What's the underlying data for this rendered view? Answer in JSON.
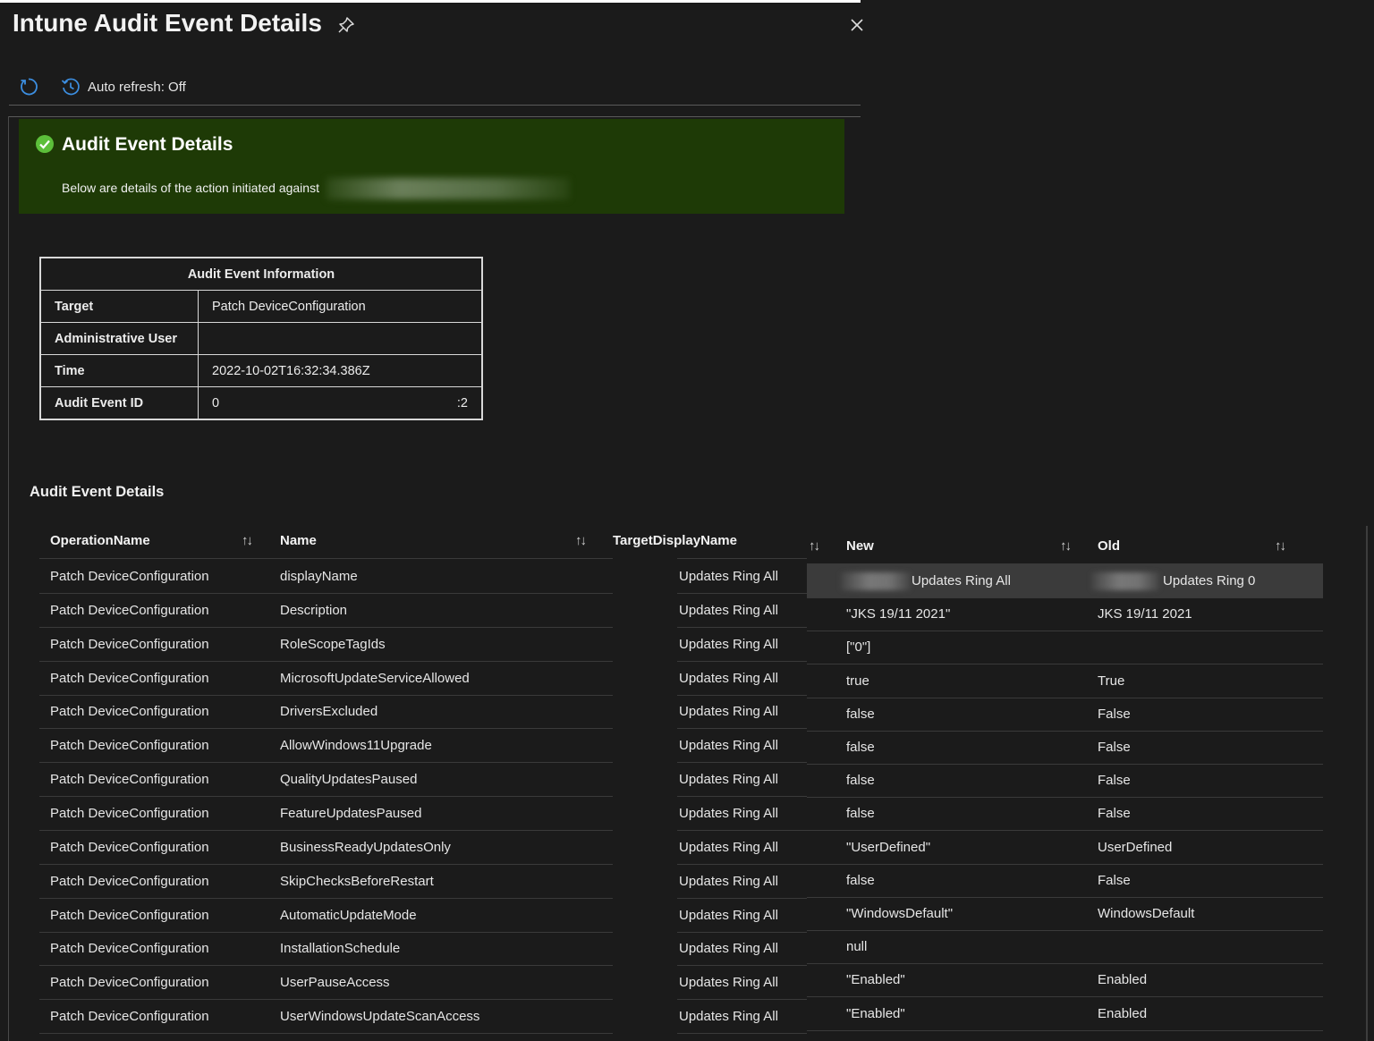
{
  "header": {
    "title": "Intune Audit Event Details",
    "pin_icon": "pin-icon",
    "close_icon": "close-icon"
  },
  "toolbar": {
    "refresh_icon": "refresh-icon",
    "history_icon": "history-icon",
    "auto_refresh_label": "Auto refresh: Off"
  },
  "banner": {
    "icon": "check-circle-icon",
    "title": "Audit Event Details",
    "text": "Below are details of the action initiated against",
    "color": "#1e3a06"
  },
  "info_table": {
    "heading": "Audit Event Information",
    "rows": [
      {
        "label": "Target",
        "value": "Patch DeviceConfiguration"
      },
      {
        "label": "Administrative User",
        "value": ""
      },
      {
        "label": "Time",
        "value": "2022-10-02T16:32:34.386Z"
      },
      {
        "label": "Audit Event ID",
        "value": "0",
        "value_end": ":2"
      }
    ]
  },
  "details": {
    "title": "Audit Event Details",
    "columns": {
      "operation": "OperationName",
      "name": "Name",
      "target": "TargetDisplayName",
      "new": "New",
      "old": "Old"
    },
    "sort_icon": "↑↓",
    "rows": [
      {
        "op": "Patch DeviceConfiguration",
        "name": "displayName",
        "target": "Updates Ring All",
        "new": "Updates Ring All",
        "old": "Updates Ring 0"
      },
      {
        "op": "Patch DeviceConfiguration",
        "name": "Description",
        "target": "Updates Ring All",
        "new": "\"JKS 19/11 2021\"",
        "old": "JKS 19/11 2021"
      },
      {
        "op": "Patch DeviceConfiguration",
        "name": "RoleScopeTagIds",
        "target": "Updates Ring All",
        "new": "[\"0\"]",
        "old": ""
      },
      {
        "op": "Patch DeviceConfiguration",
        "name": "MicrosoftUpdateServiceAllowed",
        "target": "Updates Ring All",
        "new": "true",
        "old": "True"
      },
      {
        "op": "Patch DeviceConfiguration",
        "name": "DriversExcluded",
        "target": "Updates Ring All",
        "new": "false",
        "old": "False"
      },
      {
        "op": "Patch DeviceConfiguration",
        "name": "AllowWindows11Upgrade",
        "target": "Updates Ring All",
        "new": "false",
        "old": "False"
      },
      {
        "op": "Patch DeviceConfiguration",
        "name": "QualityUpdatesPaused",
        "target": "Updates Ring All",
        "new": "false",
        "old": "False"
      },
      {
        "op": "Patch DeviceConfiguration",
        "name": "FeatureUpdatesPaused",
        "target": "Updates Ring All",
        "new": "false",
        "old": "False"
      },
      {
        "op": "Patch DeviceConfiguration",
        "name": "BusinessReadyUpdatesOnly",
        "target": "Updates Ring All",
        "new": "\"UserDefined\"",
        "old": "UserDefined"
      },
      {
        "op": "Patch DeviceConfiguration",
        "name": "SkipChecksBeforeRestart",
        "target": "Updates Ring All",
        "new": "false",
        "old": "False"
      },
      {
        "op": "Patch DeviceConfiguration",
        "name": "AutomaticUpdateMode",
        "target": "Updates Ring All",
        "new": "\"WindowsDefault\"",
        "old": "WindowsDefault"
      },
      {
        "op": "Patch DeviceConfiguration",
        "name": "InstallationSchedule",
        "target": "Updates Ring All",
        "new": "null",
        "old": ""
      },
      {
        "op": "Patch DeviceConfiguration",
        "name": "UserPauseAccess",
        "target": "Updates Ring All",
        "new": "\"Enabled\"",
        "old": "Enabled"
      },
      {
        "op": "Patch DeviceConfiguration",
        "name": "UserWindowsUpdateScanAccess",
        "target": "Updates Ring All",
        "new": "\"Enabled\"",
        "old": "Enabled"
      }
    ]
  }
}
